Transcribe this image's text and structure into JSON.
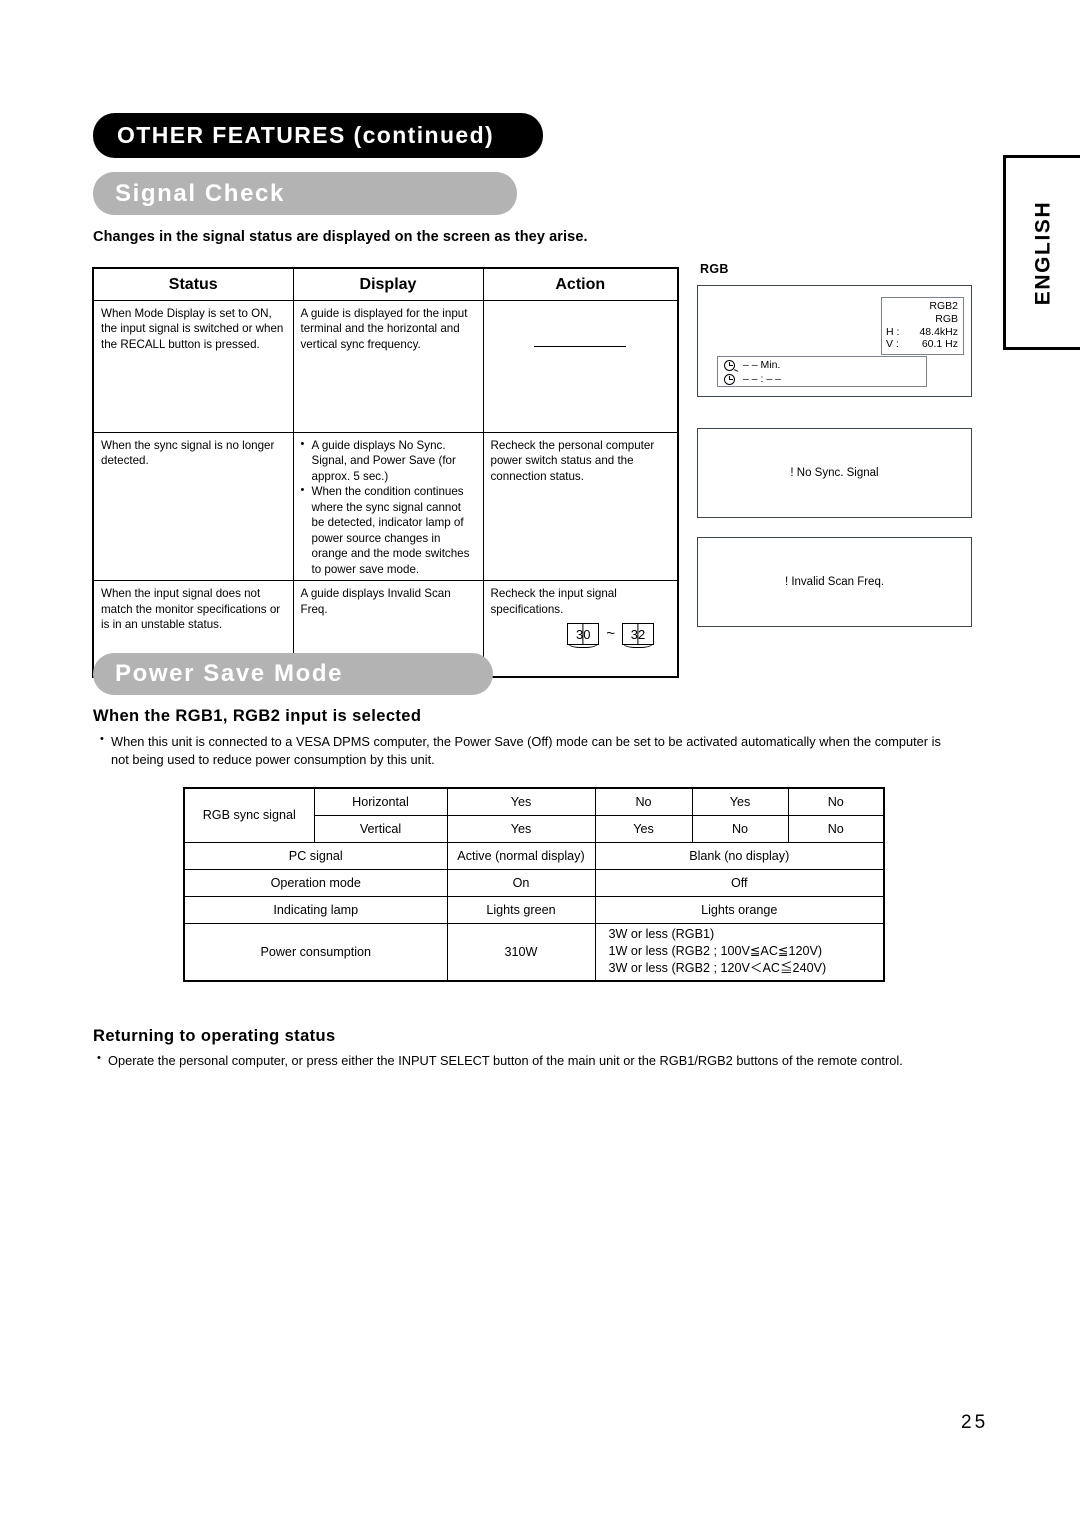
{
  "header": {
    "section_title": "OTHER FEATURES (continued)",
    "subsection_title": "Signal Check",
    "intro": "Changes in the signal status are displayed on the screen as they arise."
  },
  "side_tab": {
    "label": "ENGLISH"
  },
  "signal_table": {
    "headers": [
      "Status",
      "Display",
      "Action"
    ],
    "rows": [
      {
        "status": "When Mode Display is set to ON, the input signal is switched or when the RECALL button is pressed.",
        "display": "A guide is displayed for the input terminal and the horizontal and vertical sync frequency.",
        "action": ""
      },
      {
        "status": "When the sync signal is no longer detected.",
        "display_bullets": [
          "A guide displays No Sync. Signal, and Power Save (for approx. 5 sec.)",
          "When the condition continues where the sync signal cannot be detected, indicator lamp of power source changes in orange and the mode switches to power save mode."
        ],
        "action": "Recheck the personal computer power switch status and the connection status."
      },
      {
        "status": "When the input signal does not match the monitor specifications or is in an unstable status.",
        "display": "A guide displays Invalid Scan Freq.",
        "action": "Recheck the input signal specifications.",
        "ref_from": "30",
        "ref_tilde": "~",
        "ref_to": "32"
      }
    ]
  },
  "rgb_screens": {
    "label": "RGB",
    "screen1": {
      "input": "RGB2",
      "mode": "RGB",
      "h_key": "H :",
      "h_value": "48.4kHz",
      "v_key": "V :",
      "v_value": "60.1  Hz",
      "timer_value": "– – Min.",
      "clock_value": "– – : – –",
      "timer_icon": "timer-icon",
      "clock_icon": "clock-icon"
    },
    "screen2": {
      "message": "! No Sync. Signal"
    },
    "screen3": {
      "message": "! Invalid Scan Freq."
    }
  },
  "power_save": {
    "banner": "Power Save Mode",
    "heading": "When the RGB1, RGB2 input is selected",
    "note": "When this unit is connected to a VESA DPMS computer, the Power Save (Off) mode can be set to be activated automatically when the computer is not being used to reduce power consumption by this unit.",
    "table": {
      "rgb_sync_label": "RGB sync signal",
      "horizontal_label": "Horizontal",
      "vertical_label": "Vertical",
      "horizontal_values": [
        "Yes",
        "No",
        "Yes",
        "No"
      ],
      "vertical_values": [
        "Yes",
        "Yes",
        "No",
        "No"
      ],
      "pc_signal_label": "PC signal",
      "pc_signal_active": "Active (normal display)",
      "pc_signal_blank": "Blank (no display)",
      "operation_mode_label": "Operation mode",
      "operation_mode_on": "On",
      "operation_mode_off": "Off",
      "indicating_lamp_label": "Indicating lamp",
      "indicating_lamp_on": "Lights green",
      "indicating_lamp_off": "Lights orange",
      "power_consumption_label": "Power consumption",
      "power_consumption_on": "310W",
      "power_consumption_off_lines": [
        "3W or less (RGB1)",
        "1W or less (RGB2 ; 100V≦AC≦120V)",
        "3W or less (RGB2 ; 120V＜AC≦240V)"
      ]
    }
  },
  "returning": {
    "heading": "Returning to operating status",
    "note": "Operate the personal computer, or press either the INPUT SELECT button of the main unit or the RGB1/RGB2 buttons of the remote control."
  },
  "page_number": "25"
}
